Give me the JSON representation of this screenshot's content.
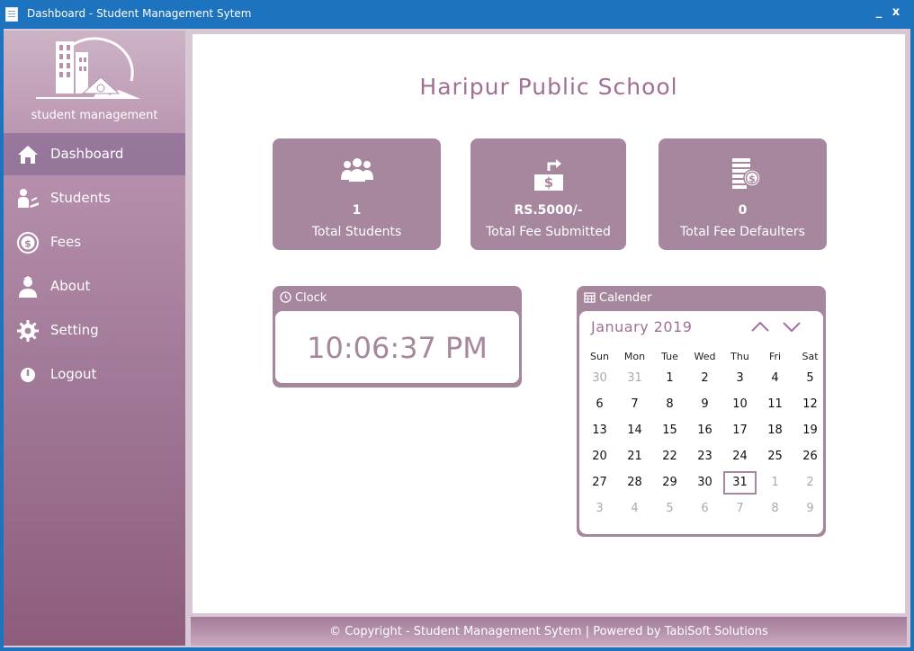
{
  "window": {
    "title": "Dashboard - Student Management Sytem",
    "minimize_label": "_",
    "close_label": "x"
  },
  "sidebar": {
    "logo_text": "student management",
    "items": [
      {
        "label": "Dashboard",
        "icon": "home-icon",
        "active": true
      },
      {
        "label": "Students",
        "icon": "student-icon"
      },
      {
        "label": "Fees",
        "icon": "coin-icon"
      },
      {
        "label": "About",
        "icon": "user-icon"
      },
      {
        "label": "Setting",
        "icon": "gear-icon"
      },
      {
        "label": "Logout",
        "icon": "power-icon"
      }
    ]
  },
  "main": {
    "school_name": "Haripur Public School",
    "stats": [
      {
        "value": "1",
        "label": "Total Students",
        "icon": "group-icon"
      },
      {
        "value": "RS.5000/-",
        "label": "Total Fee Submitted",
        "icon": "money-transfer-icon"
      },
      {
        "value": "0",
        "label": "Total Fee Defaulters",
        "icon": "coins-icon"
      }
    ],
    "clock": {
      "header": "Clock",
      "time": "10:06:37 PM"
    },
    "calendar": {
      "header": "Calender",
      "month_label": "January  2019",
      "weekdays": [
        "Sun",
        "Mon",
        "Tue",
        "Wed",
        "Thu",
        "Fri",
        "Sat"
      ],
      "weeks": [
        [
          "30",
          "31",
          "1",
          "2",
          "3",
          "4",
          "5"
        ],
        [
          "6",
          "7",
          "8",
          "9",
          "10",
          "11",
          "12"
        ],
        [
          "13",
          "14",
          "15",
          "16",
          "17",
          "18",
          "19"
        ],
        [
          "20",
          "21",
          "22",
          "23",
          "24",
          "25",
          "26"
        ],
        [
          "27",
          "28",
          "29",
          "30",
          "31",
          "1",
          "2"
        ],
        [
          "3",
          "4",
          "5",
          "6",
          "7",
          "8",
          "9"
        ]
      ],
      "selected_day": "31"
    }
  },
  "footer": {
    "text": "© Copyright - Student Management Sytem | Powered by TabiSoft Solutions"
  },
  "colors": {
    "accent": "#a6879d",
    "title_bar": "#1e73be",
    "heading": "#a16f95"
  }
}
